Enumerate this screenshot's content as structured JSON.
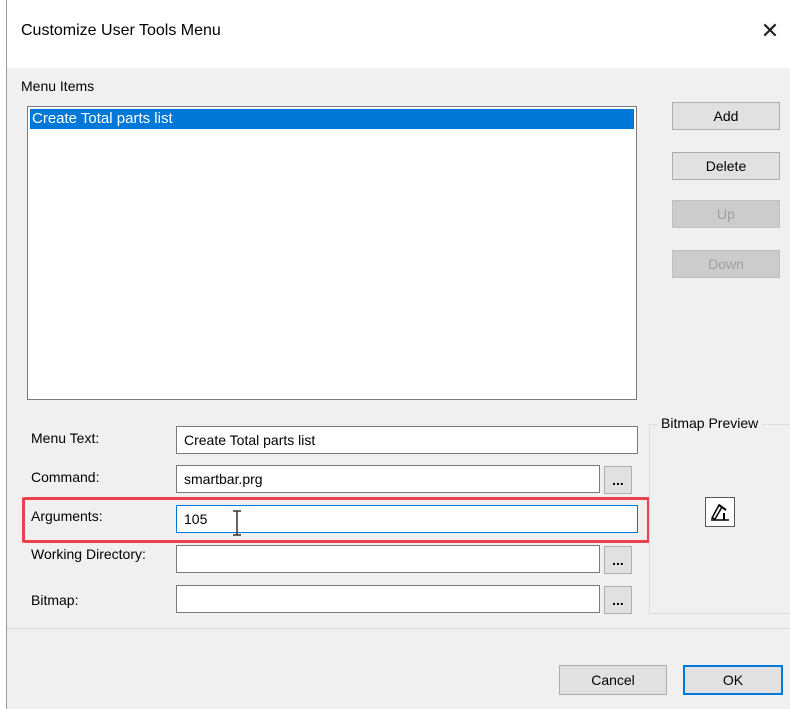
{
  "dialog": {
    "title": "Customize User Tools Menu",
    "close_glyph": "✕"
  },
  "menu_items": {
    "label": "Menu Items",
    "items": [
      "Create Total parts list"
    ],
    "selected_index": 0
  },
  "side_buttons": {
    "add": "Add",
    "delete": "Delete",
    "up": "Up",
    "down": "Down"
  },
  "fields": {
    "menu_text": {
      "label": "Menu Text:",
      "value": "Create Total parts list"
    },
    "command": {
      "label": "Command:",
      "value": "smartbar.prg",
      "browse": "..."
    },
    "arguments": {
      "label": "Arguments:",
      "value": "105"
    },
    "working_directory": {
      "label": "Working Directory:",
      "value": "",
      "browse": "..."
    },
    "bitmap": {
      "label": "Bitmap:",
      "value": "",
      "browse": "..."
    }
  },
  "bitmap_preview": {
    "title": "Bitmap Preview",
    "icon": "hammer-icon"
  },
  "footer": {
    "cancel": "Cancel",
    "ok": "OK"
  },
  "colors": {
    "selection": "#0078d7",
    "highlight": "#e8424f",
    "dialog_bg": "#f0f0f0"
  }
}
